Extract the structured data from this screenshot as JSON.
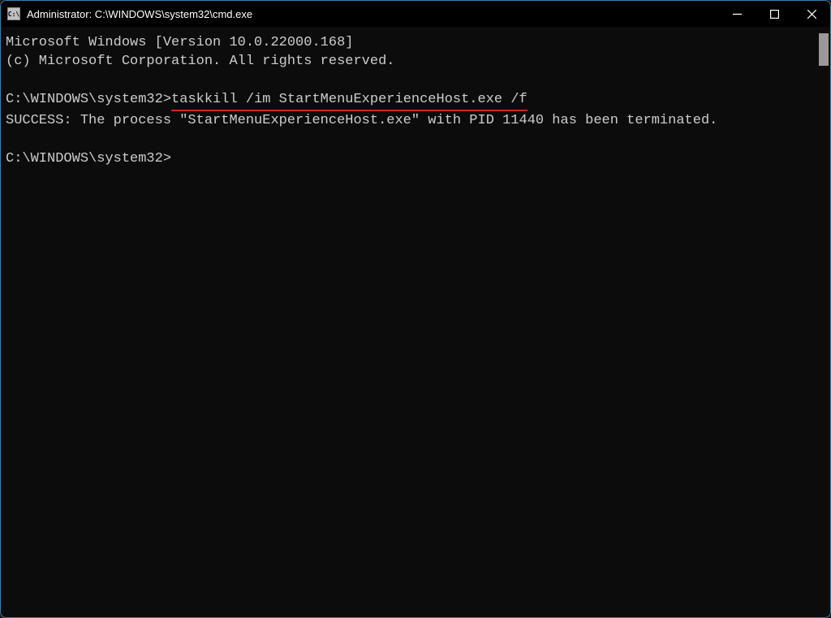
{
  "window": {
    "title": "Administrator: C:\\WINDOWS\\system32\\cmd.exe",
    "icon_text": "C:\\"
  },
  "terminal": {
    "line1": "Microsoft Windows [Version 10.0.22000.168]",
    "line2": "(c) Microsoft Corporation. All rights reserved.",
    "prompt1": "C:\\WINDOWS\\system32>",
    "command1": "taskkill /im StartMenuExperienceHost.exe /f",
    "output1": "SUCCESS: The process \"StartMenuExperienceHost.exe\" with PID 11440 has been terminated.",
    "prompt2": "C:\\WINDOWS\\system32>"
  }
}
